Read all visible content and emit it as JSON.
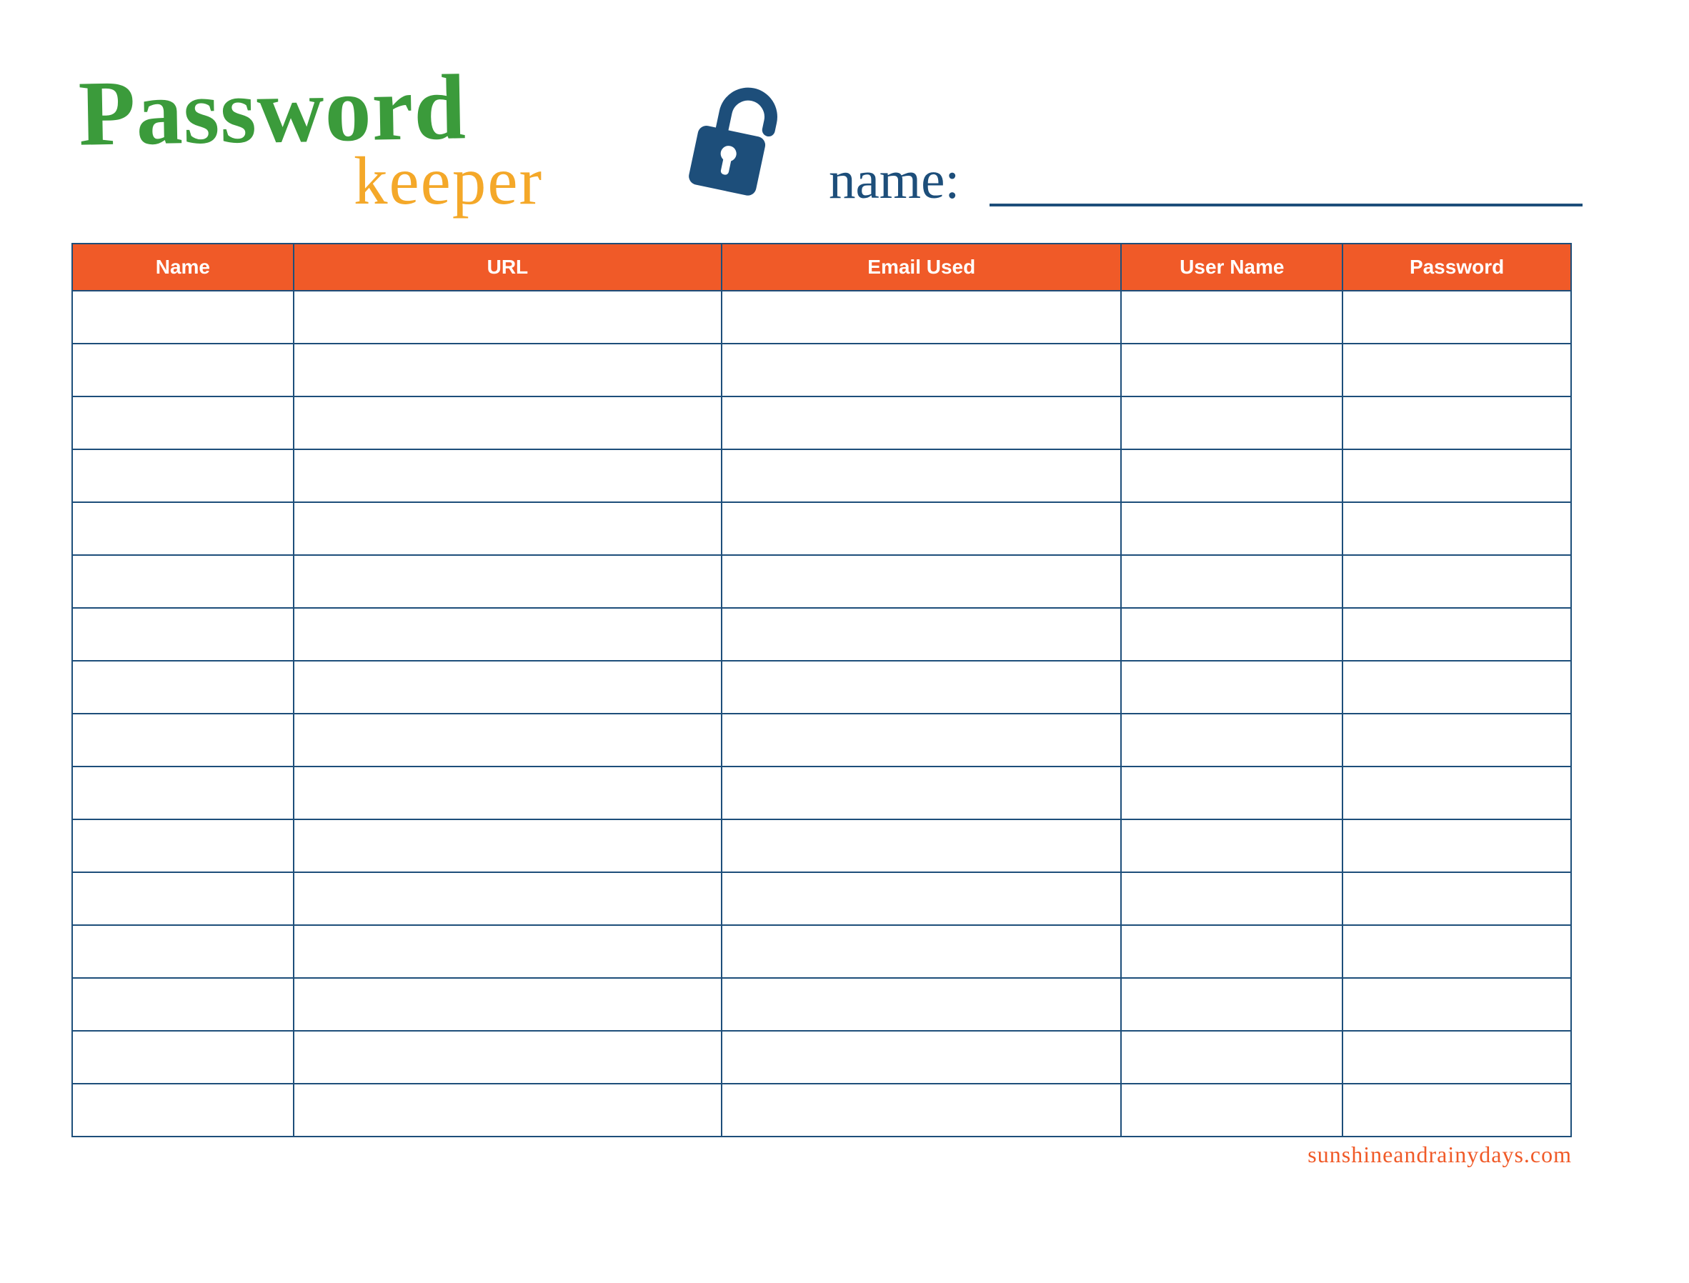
{
  "header": {
    "title_main": "Password",
    "title_sub": "keeper",
    "name_label": "name:",
    "icon": "lock-icon"
  },
  "table": {
    "columns": [
      "Name",
      "URL",
      "Email Used",
      "User Name",
      "Password"
    ],
    "row_count": 16
  },
  "footer": {
    "credit": "sunshineandrainydays.com"
  },
  "colors": {
    "green": "#3b9b3b",
    "gold": "#f4a829",
    "navy": "#1d4e7a",
    "orange": "#f05a28"
  }
}
